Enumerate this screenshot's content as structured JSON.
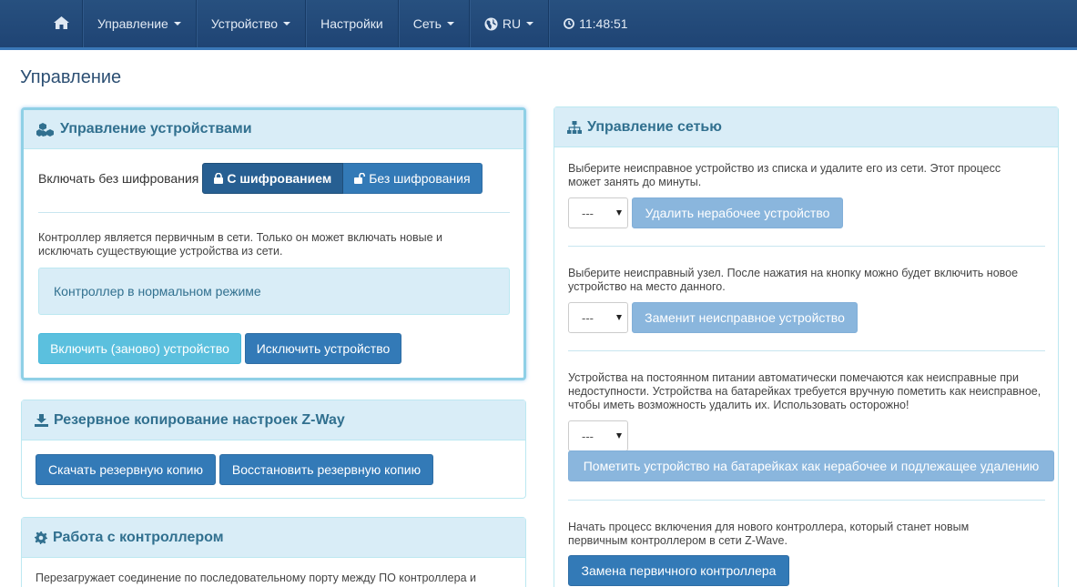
{
  "navbar": {
    "items": [
      {
        "label": "Управление"
      },
      {
        "label": "Устройство"
      },
      {
        "label": "Настройки"
      },
      {
        "label": "Сеть"
      },
      {
        "label": "RU"
      },
      {
        "label": "11:48:51"
      }
    ]
  },
  "page_title": "Управление",
  "device_management": {
    "title": "Управление устройствами",
    "include_label": "Включать без шифрования",
    "btn_secure": "С шифрованием",
    "btn_insecure": "Без шифрования",
    "description": "Контроллер является первичным в сети. Только он может включать новые и исключать существующие устройства из сети.",
    "status": "Контроллер в нормальном режиме",
    "btn_include": "Включить (заново) устройство",
    "btn_exclude": "Исключить устройство"
  },
  "backup": {
    "title": "Резервное копирование настроек Z-Way",
    "btn_download": "Скачать резервную копию",
    "btn_restore": "Восстановить резервную копию"
  },
  "controller": {
    "title": "Работа с контроллером",
    "description": "Перезагружает соединение по последовательному порту между ПО контроллера и"
  },
  "network": {
    "title": "Управление сетью",
    "section1": {
      "text": "Выберите неисправное устройство из списка и удалите его из сети. Этот процесс может занять до минуты.",
      "select": "---",
      "button": "Удалить нерабочее устройство"
    },
    "section2": {
      "text": "Выберите неисправный узел. После нажатия на кнопку можно будет включить новое устройство на место данного.",
      "select": "---",
      "button": "Заменит неисправное устройство"
    },
    "section3": {
      "text": "Устройства на постоянном питании автоматически помечаются как неисправные при недоступности. Устройства на батарейках требуется вручную пометить как неисправное, чтобы иметь возможность удалить их. Использовать осторожно!",
      "select": "---",
      "button": "Пометить устройство на батарейках как нерабочее и подлежащее удалению"
    },
    "section4": {
      "text": "Начать процесс включения для нового контроллера, который станет новым первичным контроллером в сети Z-Wave.",
      "button": "Замена первичного контроллера"
    }
  },
  "icons": {
    "home": "home-icon",
    "globe": "globe-icon",
    "clock": "clock-icon",
    "cubes": "cubes-icon",
    "lock": "lock-icon",
    "unlock": "unlock-icon",
    "download": "download-icon",
    "gear": "gear-icon",
    "sitemap": "sitemap-icon"
  },
  "colors": {
    "navbar": "#1f4474",
    "primary": "#337ab7",
    "info_panel": "#d9edf7"
  }
}
